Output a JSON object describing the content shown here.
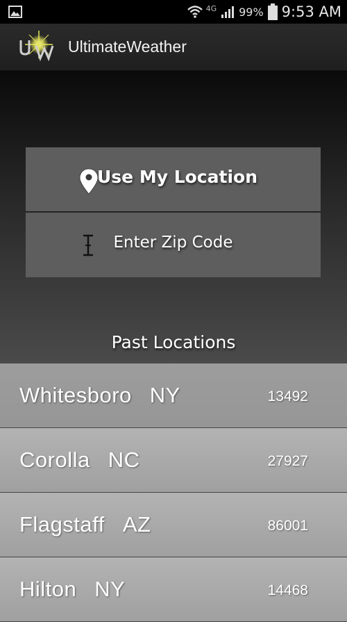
{
  "status_bar": {
    "network": "4G",
    "battery": "99%",
    "time": "9:53 AM"
  },
  "app": {
    "title": "UltimateWeather",
    "logo_icon": "uw-logo-icon",
    "accent": "#e6e65a"
  },
  "actions": {
    "use_location_label": "Use My Location",
    "use_location_icon": "location-pin-icon",
    "enter_zip_label": "Enter Zip Code",
    "enter_zip_icon": "text-cursor-icon"
  },
  "past_locations": {
    "title": "Past Locations",
    "items": [
      {
        "city": "Whitesboro",
        "state": "NY",
        "zip": "13492"
      },
      {
        "city": "Corolla",
        "state": "NC",
        "zip": "27927"
      },
      {
        "city": "Flagstaff",
        "state": "AZ",
        "zip": "86001"
      },
      {
        "city": "Hilton",
        "state": "NY",
        "zip": "14468"
      }
    ]
  }
}
